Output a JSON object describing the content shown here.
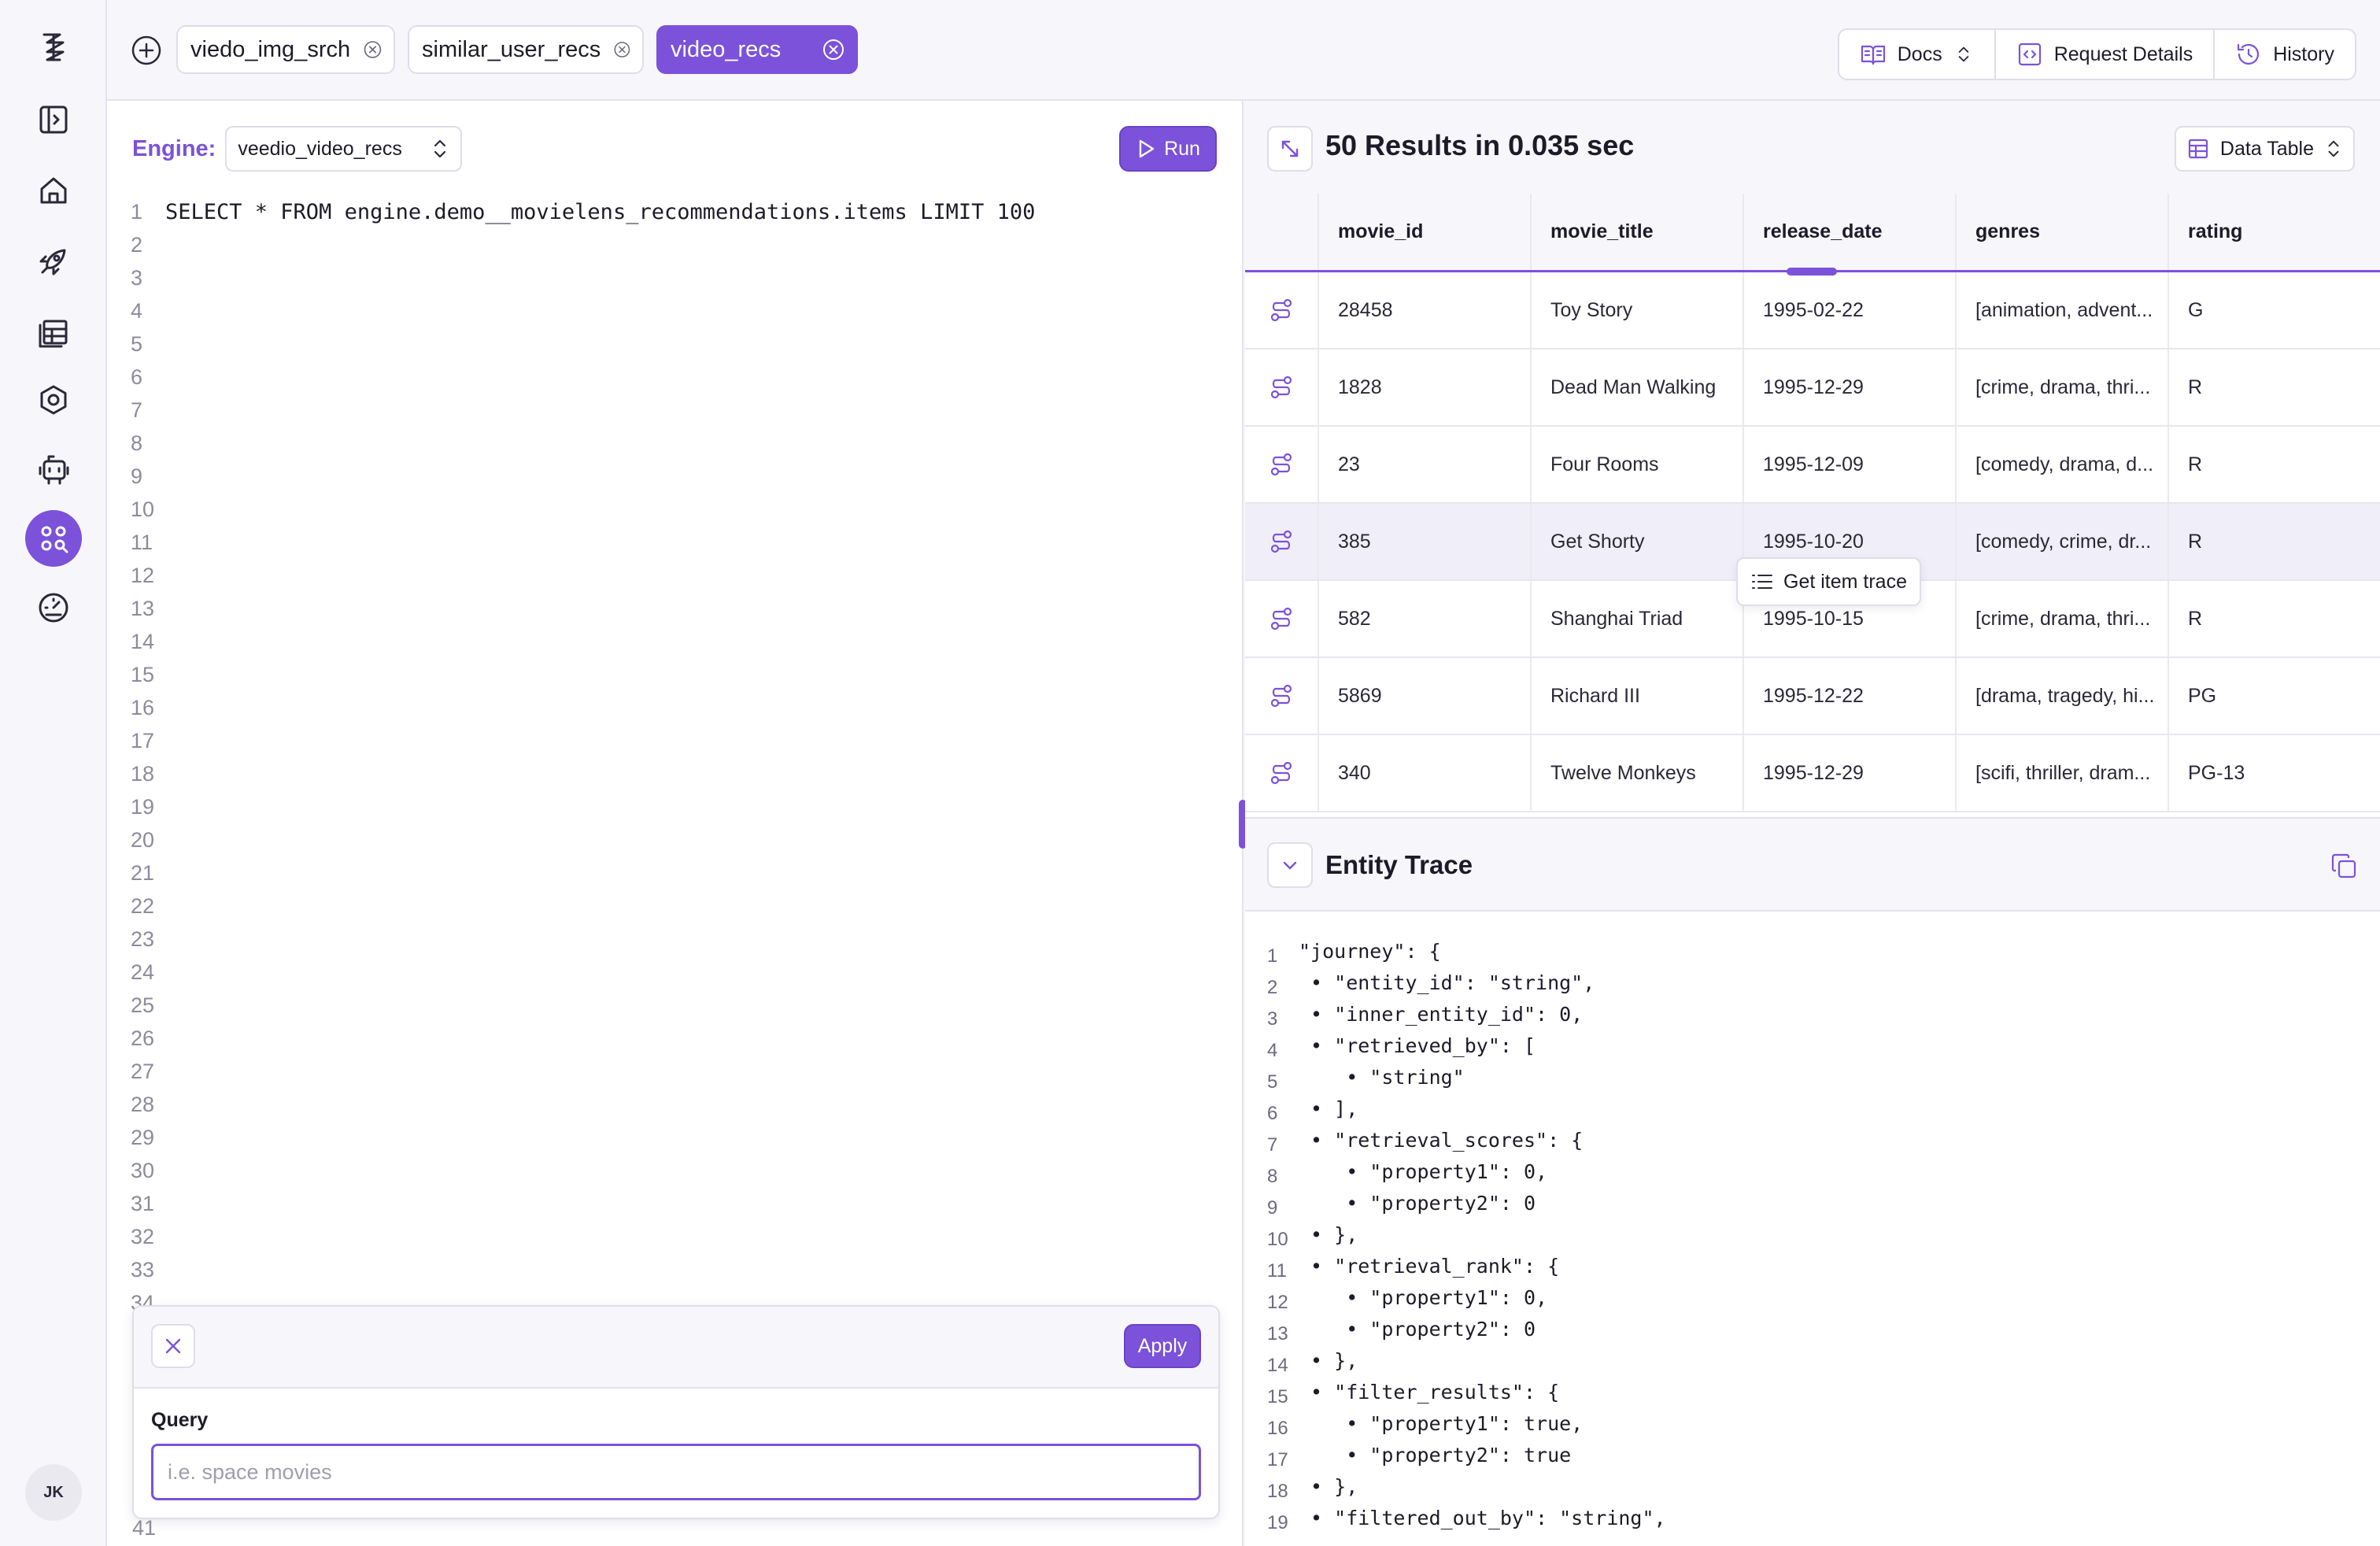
{
  "rail": {
    "icons": [
      "logo-icon",
      "sidebar-toggle-icon",
      "home-icon",
      "rocket-icon",
      "table-icon",
      "hexagon-settings-icon",
      "robot-icon",
      "search-apps-icon",
      "gauge-icon"
    ],
    "active": "search-apps-icon",
    "avatar_initials": "JK"
  },
  "tabs": [
    {
      "label": "viedo_img_srch",
      "active": false
    },
    {
      "label": "similar_user_recs",
      "active": false
    },
    {
      "label": "video_recs",
      "active": true
    }
  ],
  "top_actions": {
    "docs": "Docs",
    "request_details": "Request Details",
    "history": "History"
  },
  "editor": {
    "engine_label": "Engine:",
    "engine_value": "veedio_video_recs",
    "run_label": "Run",
    "code_lines": [
      "SELECT * FROM engine.demo__movielens_recommendations.items LIMIT 100",
      "",
      "",
      "",
      "",
      "",
      "",
      "",
      "",
      "",
      "",
      "",
      "",
      "",
      "",
      "",
      "",
      "",
      "",
      "",
      "",
      "",
      "",
      "",
      "",
      "",
      "",
      "",
      "",
      "",
      "",
      "",
      "",
      ""
    ],
    "bottom_line_number": "41"
  },
  "query_panel": {
    "apply_label": "Apply",
    "label": "Query",
    "placeholder": "i.e. space movies",
    "value": ""
  },
  "results": {
    "title": "50 Results in 0.035 sec",
    "view_label": "Data Table",
    "columns": [
      "movie_id",
      "movie_title",
      "release_date",
      "genres",
      "rating"
    ],
    "rows": [
      [
        "28458",
        "Toy Story",
        "1995-02-22",
        "[animation, advent...",
        "G"
      ],
      [
        "1828",
        "Dead Man Walking",
        "1995-12-29",
        "[crime, drama, thri...",
        "R"
      ],
      [
        "23",
        "Four Rooms",
        "1995-12-09",
        "[comedy, drama, d...",
        "R"
      ],
      [
        "385",
        "Get Shorty",
        "1995-10-20",
        "[comedy, crime, dr...",
        "R"
      ],
      [
        "582",
        "Shanghai Triad",
        "1995-10-15",
        "[crime, drama, thri...",
        "R"
      ],
      [
        "5869",
        "Richard III",
        "1995-12-22",
        "[drama, tragedy, hi...",
        "PG"
      ],
      [
        "340",
        "Twelve Monkeys",
        "1995-12-29",
        "[scifi, thriller, dram...",
        "PG-13"
      ]
    ],
    "highlighted_row": 3,
    "tooltip": "Get item trace"
  },
  "trace": {
    "title": "Entity Trace",
    "lines": [
      "\"journey\": {",
      " • \"entity_id\": \"string\",",
      " • \"inner_entity_id\": 0,",
      " • \"retrieved_by\": [",
      "    • \"string\"",
      " • ],",
      " • \"retrieval_scores\": {",
      "    • \"property1\": 0,",
      "    • \"property2\": 0",
      " • },",
      " • \"retrieval_rank\": {",
      "    • \"property1\": 0,",
      "    • \"property2\": 0",
      " • },",
      " • \"filter_results\": {",
      "    • \"property1\": true,",
      "    • \"property2\": true",
      " • },",
      " • \"filtered_out_by\": \"string\","
    ]
  },
  "colors": {
    "accent": "#7b52d9",
    "background": "#f7f6fb",
    "border": "#e0dde8"
  }
}
